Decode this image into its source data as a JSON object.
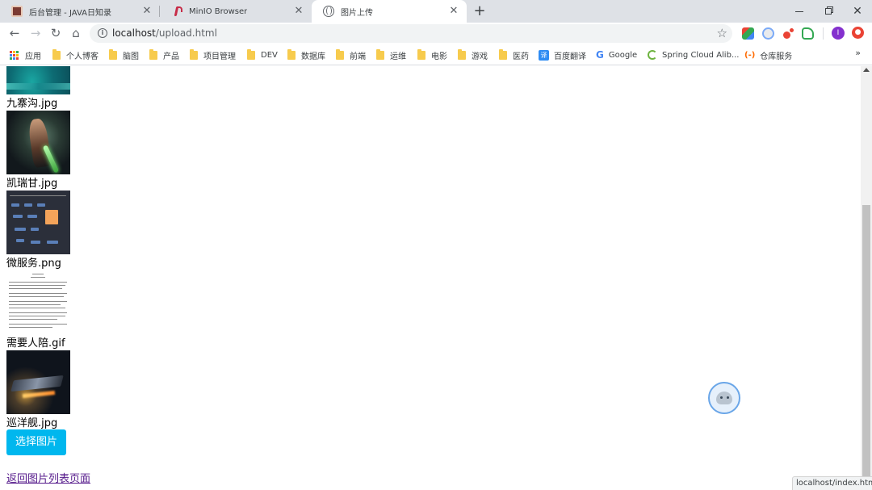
{
  "tabs": [
    {
      "title": "后台管理 - JAVA日知录",
      "icon": "admin-favicon",
      "active": false
    },
    {
      "title": "MinIO Browser",
      "icon": "minio-favicon",
      "active": false
    },
    {
      "title": "图片上传",
      "icon": "globe-favicon",
      "active": true
    }
  ],
  "toolbar": {
    "url_host": "localhost",
    "url_path": "/upload.html",
    "profile_initial": "I"
  },
  "bookmarks": [
    {
      "label": "应用",
      "kind": "apps"
    },
    {
      "label": "个人博客",
      "kind": "folder"
    },
    {
      "label": "脑图",
      "kind": "folder"
    },
    {
      "label": "产品",
      "kind": "folder"
    },
    {
      "label": "项目管理",
      "kind": "folder"
    },
    {
      "label": "DEV",
      "kind": "folder"
    },
    {
      "label": "数据库",
      "kind": "folder"
    },
    {
      "label": "前端",
      "kind": "folder"
    },
    {
      "label": "运维",
      "kind": "folder"
    },
    {
      "label": "电影",
      "kind": "folder"
    },
    {
      "label": "游戏",
      "kind": "folder"
    },
    {
      "label": "医药",
      "kind": "folder"
    },
    {
      "label": "百度翻译",
      "kind": "fanyi"
    },
    {
      "label": "Google",
      "kind": "google"
    },
    {
      "label": "Spring Cloud Alib...",
      "kind": "spring"
    },
    {
      "label": "仓库服务",
      "kind": "cang"
    }
  ],
  "page": {
    "images": [
      {
        "name": "九寨沟.jpg"
      },
      {
        "name": "凯瑞甘.jpg"
      },
      {
        "name": "微服务.png"
      },
      {
        "name": "需要人陪.gif"
      },
      {
        "name": "巡洋舰.jpg"
      }
    ],
    "choose_button": "选择图片",
    "back_link": "返回图片列表页面"
  },
  "status_url": "localhost/index.html",
  "colors": {
    "button": "#00b7ee",
    "visited_link": "#551a8b"
  }
}
